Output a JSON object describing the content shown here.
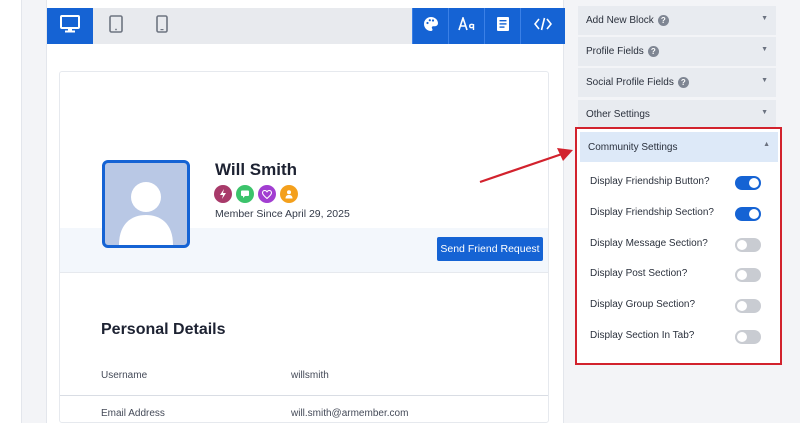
{
  "colors": {
    "primary": "#1563d4",
    "highlight_border": "#d2222d",
    "toggle_off": "#c9ccd2"
  },
  "toolbar": {
    "devices": [
      {
        "name": "desktop-view-icon",
        "active": true
      },
      {
        "name": "tablet-view-icon",
        "active": false
      },
      {
        "name": "mobile-view-icon",
        "active": false
      }
    ],
    "tools": [
      "palette-icon",
      "typography-icon",
      "document-icon",
      "code-icon"
    ]
  },
  "profile": {
    "name": "Will Smith",
    "member_since": "Member Since April 29, 2025",
    "badges": [
      {
        "icon": "lightning-icon",
        "color": "#a83a6a"
      },
      {
        "icon": "chat-icon",
        "color": "#3cc36b"
      },
      {
        "icon": "heart-icon",
        "color": "#a23ed1"
      },
      {
        "icon": "user-icon",
        "color": "#f4a01c"
      }
    ],
    "friend_button": "Send Friend Request"
  },
  "personal_details": {
    "title": "Personal Details",
    "rows": [
      {
        "label": "Username",
        "value": "willsmith"
      },
      {
        "label": "Email Address",
        "value": "will.smith@armember.com"
      }
    ]
  },
  "sidebar": {
    "sections": [
      {
        "label": "Add New Block",
        "help": true
      },
      {
        "label": "Profile Fields",
        "help": true
      },
      {
        "label": "Social Profile Fields",
        "help": true
      },
      {
        "label": "Other Settings",
        "help": false
      }
    ],
    "help_glyph": "?",
    "chevron_closed": "▼",
    "chevron_open": "▲",
    "community": {
      "title": "Community Settings",
      "settings": [
        {
          "label": "Display Friendship Button?",
          "enabled": true
        },
        {
          "label": "Display Friendship Section?",
          "enabled": true
        },
        {
          "label": "Display Message Section?",
          "enabled": false
        },
        {
          "label": "Display Post Section?",
          "enabled": false
        },
        {
          "label": "Display Group Section?",
          "enabled": false
        },
        {
          "label": "Display Section In Tab?",
          "enabled": false
        }
      ]
    }
  }
}
